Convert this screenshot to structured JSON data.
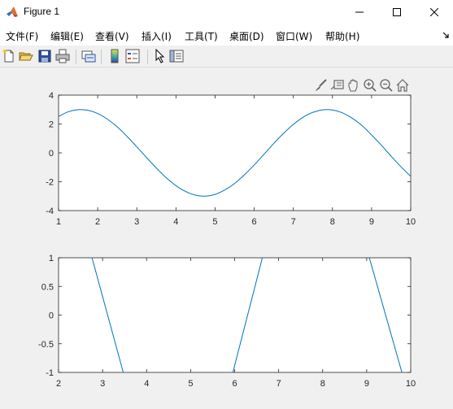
{
  "window": {
    "title": "Figure 1"
  },
  "menu": {
    "items": [
      {
        "label": "文件(F)"
      },
      {
        "label": "编辑(E)"
      },
      {
        "label": "查看(V)"
      },
      {
        "label": "插入(I)"
      },
      {
        "label": "工具(T)"
      },
      {
        "label": "桌面(D)"
      },
      {
        "label": "窗口(W)"
      },
      {
        "label": "帮助(H)"
      }
    ]
  },
  "toolbar": {
    "icons": [
      "new-figure-icon",
      "open-file-icon",
      "save-icon",
      "print-icon",
      "link-plot-icon",
      "colorbar-icon",
      "legend-icon",
      "select-arrow-icon",
      "property-inspector-icon"
    ]
  },
  "axes_toolbar": {
    "icons": [
      "brush-icon",
      "data-tips-icon",
      "pan-icon",
      "zoom-in-icon",
      "zoom-out-icon",
      "home-icon"
    ]
  },
  "chart_data": [
    {
      "type": "line",
      "x": [
        1.0,
        1.25,
        1.5,
        1.75,
        2.0,
        2.25,
        2.5,
        2.75,
        3.0,
        3.25,
        3.5,
        3.75,
        4.0,
        4.25,
        4.5,
        4.75,
        5.0,
        5.25,
        5.5,
        5.75,
        6.0,
        6.25,
        6.5,
        6.75,
        7.0,
        7.25,
        7.5,
        7.75,
        8.0,
        8.25,
        8.5,
        8.75,
        9.0,
        9.25,
        9.5,
        9.75,
        10.0
      ],
      "series": [
        {
          "values": [
            2.52,
            2.85,
            2.99,
            2.95,
            2.73,
            2.33,
            1.8,
            1.14,
            0.42,
            -0.33,
            -1.05,
            -1.72,
            -2.27,
            -2.68,
            -2.93,
            -3.0,
            -2.88,
            -2.57,
            -2.12,
            -1.52,
            -0.84,
            -0.1,
            0.65,
            1.35,
            1.97,
            2.47,
            2.81,
            2.98,
            2.97,
            2.78,
            2.41,
            1.9,
            1.24,
            0.53,
            -0.23,
            -0.96,
            -1.63
          ],
          "color": "#0072BD"
        }
      ],
      "xlim": [
        1,
        10
      ],
      "ylim": [
        -4,
        4
      ],
      "xticks": [
        1,
        2,
        3,
        4,
        5,
        6,
        7,
        8,
        9,
        10
      ],
      "yticks": [
        -4,
        -2,
        0,
        2,
        4
      ],
      "grid": false
    },
    {
      "type": "line",
      "x": [
        2.76,
        3.47,
        5.96,
        6.63,
        9.06,
        9.8
      ],
      "series": [
        {
          "values": [
            1,
            -1,
            -1,
            1,
            1,
            -1
          ],
          "segments": [
            [
              [
                2.76,
                1
              ],
              [
                3.47,
                -1
              ]
            ],
            [
              [
                5.96,
                -1
              ],
              [
                6.63,
                1
              ]
            ],
            [
              [
                9.06,
                1
              ],
              [
                9.8,
                -1
              ]
            ]
          ],
          "color": "#0072BD"
        }
      ],
      "xlim": [
        2,
        10
      ],
      "ylim": [
        -1,
        1
      ],
      "xticks": [
        2,
        3,
        4,
        5,
        6,
        7,
        8,
        9,
        10
      ],
      "yticks": [
        -1,
        -0.5,
        0,
        0.5,
        1
      ],
      "yticklabels": [
        "-1",
        "-0.5",
        "0",
        "0.5",
        "1"
      ],
      "grid": false
    }
  ]
}
